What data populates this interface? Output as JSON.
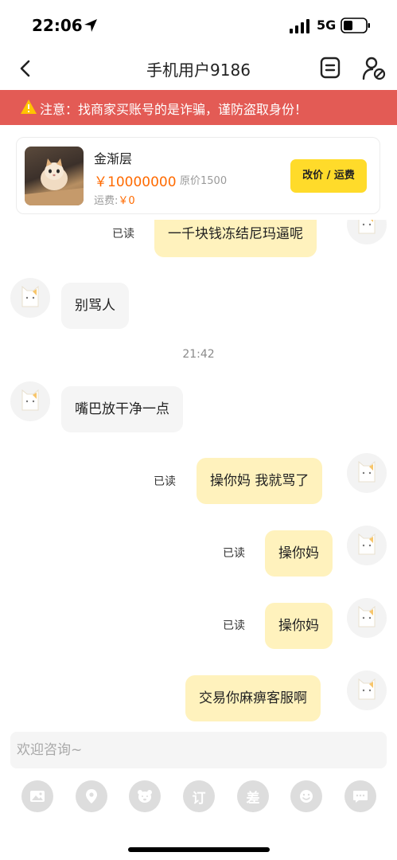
{
  "status_bar": {
    "time": "22:06",
    "network": "5G"
  },
  "nav": {
    "title": "手机用户9186",
    "icons": [
      "back-icon",
      "order-icon",
      "user-block-icon"
    ]
  },
  "warning": {
    "text": "注意：找商家买账号的是诈骗，谨防盗取身份！",
    "color": "#e35b55"
  },
  "product": {
    "name": "金渐层",
    "price": "￥10000000",
    "original_price": "原价1500",
    "shipping_label": "运费:",
    "shipping_value": "￥0",
    "action_label": "改价 / 运费"
  },
  "chat": {
    "messages": [
      {
        "side": "out",
        "text": "一千块钱冻结尼玛逼呢",
        "read": "已读"
      },
      {
        "side": "in",
        "text": "别骂人"
      },
      {
        "type": "time",
        "text": "21:42"
      },
      {
        "side": "in",
        "text": "嘴巴放干净一点"
      },
      {
        "side": "out",
        "text": "操你妈 我就骂了",
        "read": "已读"
      },
      {
        "side": "out",
        "text": "操你妈",
        "read": "已读"
      },
      {
        "side": "out",
        "text": "操你妈",
        "read": "已读"
      },
      {
        "side": "out",
        "text": "交易你麻痹客服啊"
      }
    ]
  },
  "input": {
    "placeholder": "欢迎咨询~",
    "value": ""
  },
  "toolbar": {
    "items": [
      "image-icon",
      "location-icon",
      "emoji-bear-icon",
      "订",
      "差",
      "smile-icon",
      "more-icon"
    ]
  },
  "colors": {
    "accent": "#ffdb2a",
    "price": "#ff6a00",
    "bubble_out": "#fff2bd",
    "bubble_in": "#f5f5f5"
  }
}
